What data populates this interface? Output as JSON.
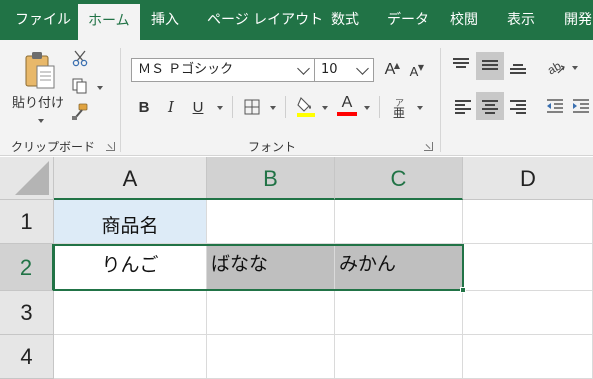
{
  "tabs": [
    {
      "label": "ファイル",
      "active": false
    },
    {
      "label": "ホーム",
      "active": true
    },
    {
      "label": "挿入",
      "active": false
    },
    {
      "label": "ページ レイアウト",
      "active": false
    },
    {
      "label": "数式",
      "active": false
    },
    {
      "label": "データ",
      "active": false
    },
    {
      "label": "校閲",
      "active": false
    },
    {
      "label": "表示",
      "active": false
    },
    {
      "label": "開発",
      "active": false
    }
  ],
  "ribbon": {
    "clipboard": {
      "paste_label": "貼り付け",
      "group_label": "クリップボード",
      "icons": [
        "paste-icon",
        "cut-icon",
        "copy-icon",
        "format-painter-icon"
      ]
    },
    "font": {
      "font_name": "ＭＳ Ｐゴシック",
      "font_size": "10",
      "increase_size_glyph": "A",
      "decrease_size_glyph": "A",
      "bold_glyph": "B",
      "italic_glyph": "I",
      "underline_glyph": "U",
      "font_color_glyph": "A",
      "phonetic_glyph": "亜",
      "group_label": "フォント",
      "fill_color": "#ffff00",
      "font_color": "#ff0000"
    },
    "alignment": {
      "icons": [
        "align-top-icon",
        "align-middle-icon",
        "align-bottom-icon",
        "orientation-icon",
        "align-left-icon",
        "align-center-icon",
        "align-right-icon",
        "decrease-indent-icon"
      ]
    }
  },
  "sheet": {
    "columns": [
      "A",
      "B",
      "C",
      "D"
    ],
    "rows": [
      "1",
      "2",
      "3",
      "4"
    ],
    "cells": {
      "A1": "商品名",
      "A2": "りんご",
      "B2": "ばなな",
      "C2": "みかん"
    },
    "selected_range": "A2:C2",
    "colors": {
      "accent": "#217346",
      "header_fill_A1": "#ddebf7",
      "cell_fill_B2_C2": "#bfbfbf"
    }
  }
}
